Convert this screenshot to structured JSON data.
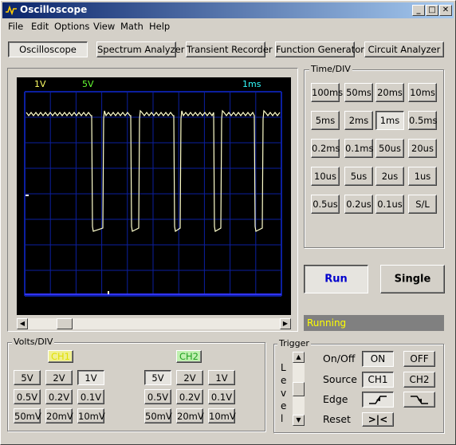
{
  "window": {
    "title": "Oscilloscope",
    "minimize_glyph": "_",
    "maximize_glyph": "□",
    "close_glyph": "✕"
  },
  "menu": [
    "File",
    "Edit",
    "Options",
    "View",
    "Math",
    "Help"
  ],
  "modes": [
    "Oscilloscope",
    "Spectrum Analyzer",
    "Transient Recorder",
    "Function Generator",
    "Circuit Analyzer"
  ],
  "active_mode": "Oscilloscope",
  "display": {
    "ch1_scale": "1V",
    "ch2_scale": "5V",
    "timebase": "1ms",
    "colors": {
      "ch1": "#ffff66",
      "ch2": "#66ff33",
      "timebase": "#33ffff",
      "grid": "#0b1fa0",
      "trace": "#ffffcc",
      "ch2_trace": "#3333ff"
    }
  },
  "time_div": {
    "label": "Time/DIV",
    "options": [
      "100ms",
      "50ms",
      "20ms",
      "10ms",
      "5ms",
      "2ms",
      "1ms",
      "0.5ms",
      "0.2ms",
      "0.1ms",
      "50us",
      "20us",
      "10us",
      "5us",
      "2us",
      "1us",
      "0.5us",
      "0.2us",
      "0.1us",
      "S/L"
    ],
    "selected": "1ms"
  },
  "run_label": "Run",
  "single_label": "Single",
  "status_text": "Running",
  "volts_div": {
    "label": "Volts/DIV",
    "ch1_label": "CH1",
    "ch2_label": "CH2",
    "options": [
      "5V",
      "2V",
      "1V",
      "0.5V",
      "0.2V",
      "0.1V",
      "50mV",
      "20mV",
      "10mV"
    ],
    "ch1_selected": "1V",
    "ch2_selected": "5V"
  },
  "trigger": {
    "label": "Trigger",
    "level_label": "Level",
    "onoff_label": "On/Off",
    "on_label": "ON",
    "off_label": "OFF",
    "source_label": "Source",
    "ch1_label": "CH1",
    "ch2_label": "CH2",
    "edge_label": "Edge",
    "reset_label": "Reset",
    "reset_glyph": ">|<",
    "selected_onoff": "ON",
    "selected_source": "CH1",
    "selected_edge": "rising"
  }
}
